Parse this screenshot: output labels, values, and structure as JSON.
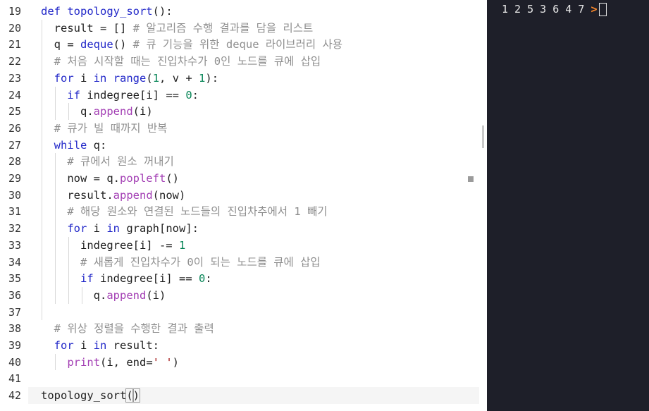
{
  "editor": {
    "lines": [
      {
        "n": "19",
        "parts": [
          {
            "t": "def ",
            "c": "kw"
          },
          {
            "t": "topology_sort",
            "c": "fn"
          },
          {
            "t": "():"
          }
        ]
      },
      {
        "n": "20",
        "parts": [
          {
            "t": "  result = [] "
          },
          {
            "t": "# 알고리즘 수행 결과를 담을 리스트",
            "c": "cm"
          }
        ]
      },
      {
        "n": "21",
        "parts": [
          {
            "t": "  q = "
          },
          {
            "t": "deque",
            "c": "fn"
          },
          {
            "t": "() "
          },
          {
            "t": "# 큐 기능을 위한 deque 라이브러리 사용",
            "c": "cm"
          }
        ]
      },
      {
        "n": "22",
        "parts": [
          {
            "t": "  "
          },
          {
            "t": "# 처음 시작할 때는 진입차수가 0인 노드를 큐에 삽입",
            "c": "cm"
          }
        ]
      },
      {
        "n": "23",
        "parts": [
          {
            "t": "  "
          },
          {
            "t": "for",
            "c": "kw"
          },
          {
            "t": " i "
          },
          {
            "t": "in",
            "c": "kw"
          },
          {
            "t": " "
          },
          {
            "t": "range",
            "c": "fn"
          },
          {
            "t": "("
          },
          {
            "t": "1",
            "c": "num"
          },
          {
            "t": ", v + "
          },
          {
            "t": "1",
            "c": "num"
          },
          {
            "t": "):"
          }
        ]
      },
      {
        "n": "24",
        "parts": [
          {
            "t": "    "
          },
          {
            "t": "if",
            "c": "kw"
          },
          {
            "t": " indegree[i] == "
          },
          {
            "t": "0",
            "c": "num"
          },
          {
            "t": ":"
          }
        ]
      },
      {
        "n": "25",
        "parts": [
          {
            "t": "      q."
          },
          {
            "t": "append",
            "c": "mt"
          },
          {
            "t": "(i)"
          }
        ]
      },
      {
        "n": "26",
        "parts": [
          {
            "t": "  "
          },
          {
            "t": "# 큐가 빌 때까지 반복",
            "c": "cm"
          }
        ]
      },
      {
        "n": "27",
        "parts": [
          {
            "t": "  "
          },
          {
            "t": "while",
            "c": "kw"
          },
          {
            "t": " q:"
          }
        ]
      },
      {
        "n": "28",
        "parts": [
          {
            "t": "    "
          },
          {
            "t": "# 큐에서 원소 꺼내기",
            "c": "cm"
          }
        ]
      },
      {
        "n": "29",
        "parts": [
          {
            "t": "    now = q."
          },
          {
            "t": "popleft",
            "c": "mt"
          },
          {
            "t": "()"
          }
        ]
      },
      {
        "n": "30",
        "parts": [
          {
            "t": "    result."
          },
          {
            "t": "append",
            "c": "mt"
          },
          {
            "t": "(now)"
          }
        ]
      },
      {
        "n": "31",
        "parts": [
          {
            "t": "    "
          },
          {
            "t": "# 해당 원소와 연결된 노드들의 진입차추에서 1 빼기",
            "c": "cm"
          }
        ]
      },
      {
        "n": "32",
        "parts": [
          {
            "t": "    "
          },
          {
            "t": "for",
            "c": "kw"
          },
          {
            "t": " i "
          },
          {
            "t": "in",
            "c": "kw"
          },
          {
            "t": " graph[now]:"
          }
        ]
      },
      {
        "n": "33",
        "parts": [
          {
            "t": "      indegree[i] -= "
          },
          {
            "t": "1",
            "c": "num"
          }
        ]
      },
      {
        "n": "34",
        "parts": [
          {
            "t": "      "
          },
          {
            "t": "# 새롭게 진입차수가 0이 되는 노드를 큐에 삽입",
            "c": "cm"
          }
        ]
      },
      {
        "n": "35",
        "parts": [
          {
            "t": "      "
          },
          {
            "t": "if",
            "c": "kw"
          },
          {
            "t": " indegree[i] == "
          },
          {
            "t": "0",
            "c": "num"
          },
          {
            "t": ":"
          }
        ]
      },
      {
        "n": "36",
        "parts": [
          {
            "t": "        q."
          },
          {
            "t": "append",
            "c": "mt"
          },
          {
            "t": "(i)"
          }
        ]
      },
      {
        "n": "37",
        "parts": []
      },
      {
        "n": "38",
        "parts": [
          {
            "t": "  "
          },
          {
            "t": "# 위상 정렬을 수행한 결과 출력",
            "c": "cm"
          }
        ]
      },
      {
        "n": "39",
        "parts": [
          {
            "t": "  "
          },
          {
            "t": "for",
            "c": "kw"
          },
          {
            "t": " i "
          },
          {
            "t": "in",
            "c": "kw"
          },
          {
            "t": " result:"
          }
        ]
      },
      {
        "n": "40",
        "parts": [
          {
            "t": "    "
          },
          {
            "t": "print",
            "c": "mt"
          },
          {
            "t": "(i, end="
          },
          {
            "t": "' '",
            "c": "str"
          },
          {
            "t": ")"
          }
        ]
      },
      {
        "n": "41",
        "parts": []
      },
      {
        "n": "42",
        "parts": [
          {
            "t": "topology_sort"
          },
          {
            "t": "(",
            "c": "bracket-hl"
          },
          {
            "t": ")",
            "c": "bracket-hl"
          }
        ],
        "current": true
      }
    ]
  },
  "terminal": {
    "output": "1 2 5 3 6 4 7",
    "prompt": ">"
  }
}
